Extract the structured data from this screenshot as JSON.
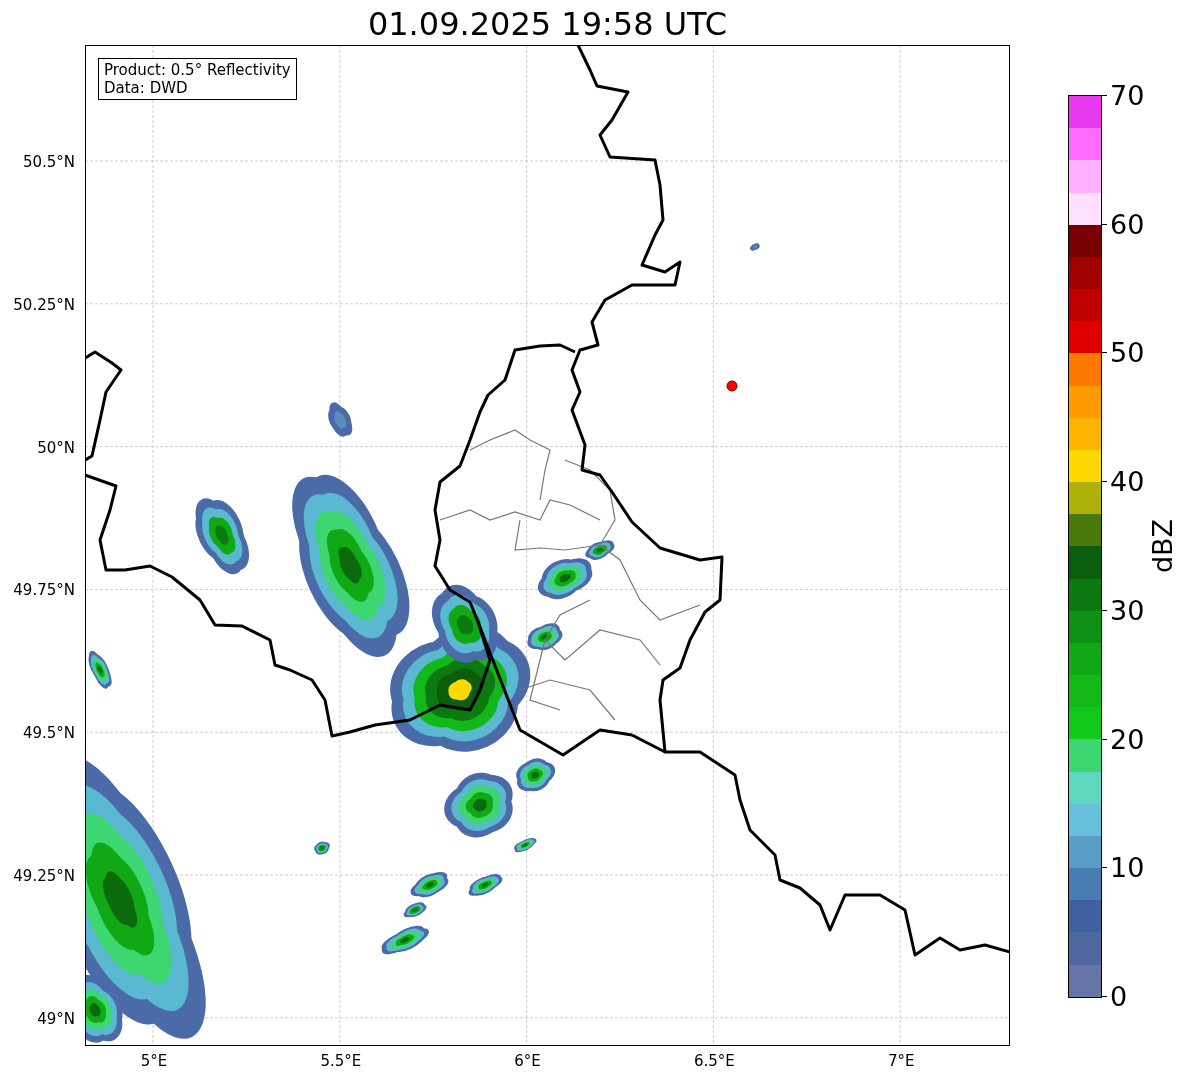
{
  "title": "01.09.2025 19:58 UTC",
  "info_box": {
    "lines": [
      "Product: 0.5° Reflectivity",
      "Data: DWD"
    ]
  },
  "map": {
    "y_ticks": [
      "50.5°N",
      "50.25°N",
      "50°N",
      "49.75°N",
      "49.5°N",
      "49.25°N",
      "49°N"
    ],
    "x_ticks": [
      "5°E",
      "5.5°E",
      "6°E",
      "6.5°E",
      "7°E"
    ]
  },
  "colorbar": {
    "label": "dBZ",
    "ticks": [
      "70",
      "60",
      "50",
      "40",
      "30",
      "20",
      "10",
      "0"
    ],
    "bands": [
      {
        "color": "#e838f0"
      },
      {
        "color": "#ff6aff"
      },
      {
        "color": "#ffb0ff"
      },
      {
        "color": "#ffe0ff"
      },
      {
        "color": "#780000"
      },
      {
        "color": "#a00000"
      },
      {
        "color": "#c00000"
      },
      {
        "color": "#e00000"
      },
      {
        "color": "#ff7800"
      },
      {
        "color": "#ff9a00"
      },
      {
        "color": "#ffb400"
      },
      {
        "color": "#ffd800"
      },
      {
        "color": "#b0b00a"
      },
      {
        "color": "#4a7a0c"
      },
      {
        "color": "#0a5e0c"
      },
      {
        "color": "#0c7a10"
      },
      {
        "color": "#0e9012"
      },
      {
        "color": "#10a814"
      },
      {
        "color": "#12b818"
      },
      {
        "color": "#10c818"
      },
      {
        "color": "#3ed670"
      },
      {
        "color": "#5fd8c0"
      },
      {
        "color": "#66c0dc"
      },
      {
        "color": "#5a9ec8"
      },
      {
        "color": "#4a7cb4"
      },
      {
        "color": "#4060a0"
      },
      {
        "color": "#5068a0"
      },
      {
        "color": "#6674a8"
      }
    ]
  }
}
